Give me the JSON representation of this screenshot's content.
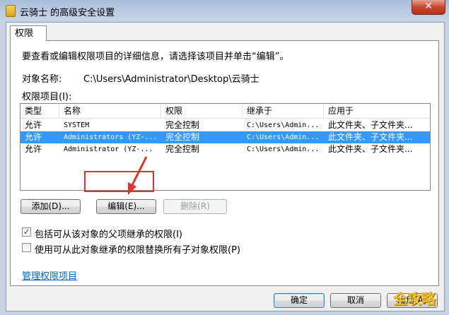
{
  "window": {
    "title": "云骑士 的高级安全设置",
    "close_glyph": "✕"
  },
  "tabs": [
    {
      "label": "权限"
    }
  ],
  "panel": {
    "intro": "要查看或编辑权限项目的详细信息，请选择该项目并单击“编辑”。",
    "object_label": "对象名称:",
    "object_value": "C:\\Users\\Administrator\\Desktop\\云骑士",
    "entries_label": "权限项目(I):"
  },
  "list": {
    "columns": [
      "类型",
      "名称",
      "权限",
      "继承于",
      "应用于"
    ],
    "rows": [
      {
        "type": "允许",
        "name": "SYSTEM",
        "permission": "完全控制",
        "inherited": "C:\\Users\\Admin...",
        "applies": "此文件夹、子文件夹...",
        "selected": false
      },
      {
        "type": "允许",
        "name": "Administrators (YZ-...",
        "permission": "完全控制",
        "inherited": "C:\\Users\\Admin...",
        "applies": "此文件夹、子文件夹...",
        "selected": true
      },
      {
        "type": "允许",
        "name": "Administrator (YZ-...",
        "permission": "完全控制",
        "inherited": "C:\\Users\\Admin...",
        "applies": "此文件夹、子文件夹...",
        "selected": false
      }
    ]
  },
  "buttons": {
    "add": "添加(D)...",
    "edit": "编辑(E)...",
    "remove": "删除(R)"
  },
  "checkboxes": [
    {
      "label": "包括可从该对象的父项继承的权限(I)",
      "checked": true
    },
    {
      "label": "使用可从此对象继承的权限替换所有子对象权限(P)",
      "checked": false
    }
  ],
  "manage_link": "管理权限项目",
  "footer": {
    "ok": "确定",
    "cancel": "取消",
    "apply": "应用(A)"
  },
  "watermark": "全攻略",
  "colors": {
    "selection": "#3399ff",
    "annotation": "#e0332f",
    "link": "#0066cc"
  }
}
